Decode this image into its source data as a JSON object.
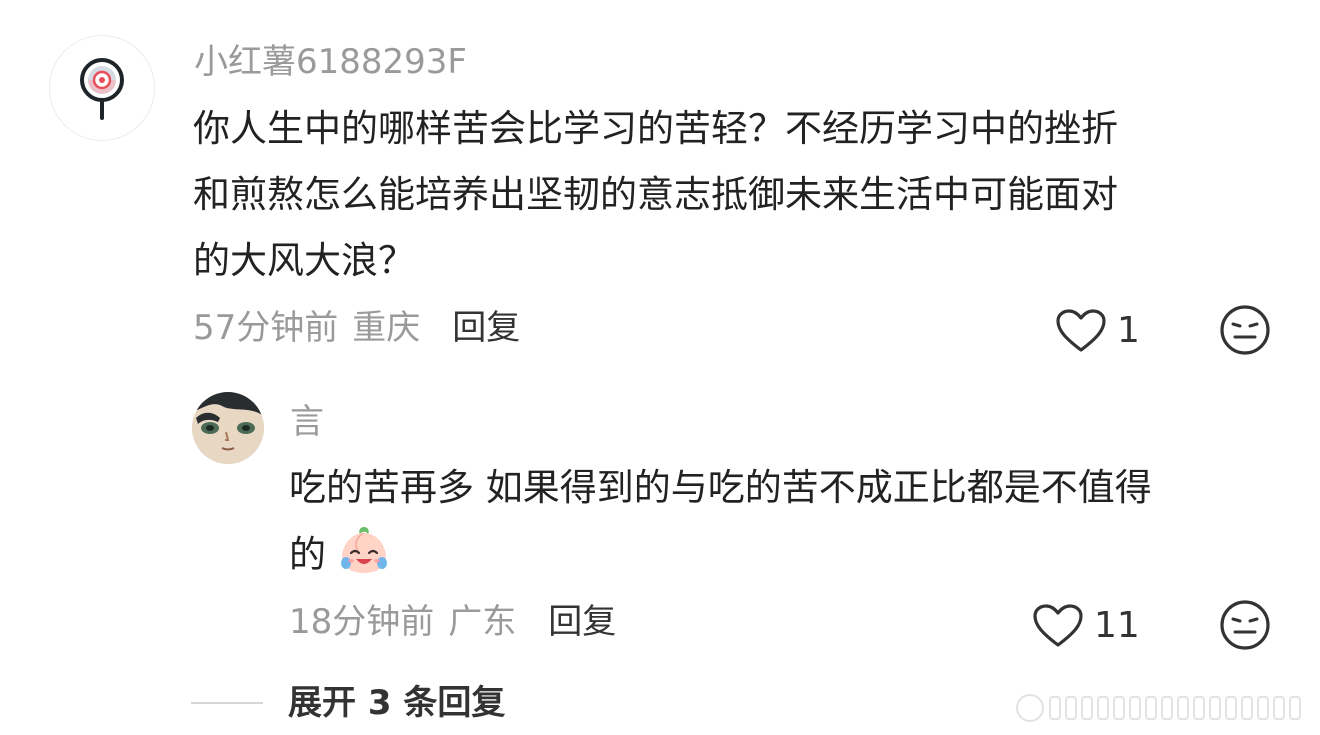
{
  "comment": {
    "username": "小红薯6188293F",
    "text_lines": [
      "你人生中的哪样苦会比学习的苦轻？不经历学习中的挫折",
      "和煎熬怎么能培养出坚韧的意志抵御未来生活中可能面对",
      "的大风大浪？"
    ],
    "time": "57分钟前",
    "location": "重庆",
    "reply_label": "回复",
    "likes": "1",
    "icons": {
      "avatar": "lollipop-avatar-icon",
      "like": "heart-icon",
      "dislike": "unamused-face-icon"
    }
  },
  "reply": {
    "username": "言",
    "text_lines": [
      "吃的苦再多 如果得到的与吃的苦不成正比都是不值得",
      "的"
    ],
    "emoji": "crying-laughing-peach-emoji",
    "time": "18分钟前",
    "location": "广东",
    "reply_label": "回复",
    "likes": "11",
    "icons": {
      "avatar": "cartoon-character-avatar-icon",
      "like": "heart-icon",
      "dislike": "unamused-face-icon"
    }
  },
  "expand_label": "展开 3 条回复",
  "colors": {
    "primary_text": "#222222",
    "secondary_text": "#9a9a9a",
    "action_text": "#333333",
    "avatar_accent": "#e94f5a"
  }
}
